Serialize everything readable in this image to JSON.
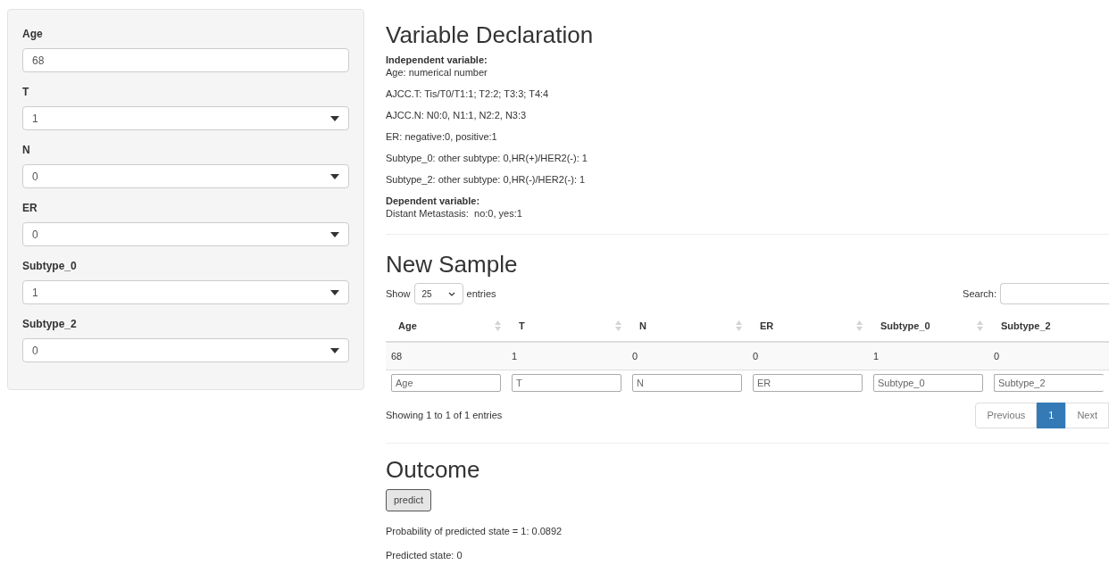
{
  "sidebar": {
    "fields": [
      {
        "label": "Age",
        "kind": "number",
        "value": "68"
      },
      {
        "label": "T",
        "kind": "select",
        "value": "1"
      },
      {
        "label": "N",
        "kind": "select",
        "value": "0"
      },
      {
        "label": "ER",
        "kind": "select",
        "value": "0"
      },
      {
        "label": "Subtype_0",
        "kind": "select",
        "value": "1"
      },
      {
        "label": "Subtype_2",
        "kind": "select",
        "value": "0"
      }
    ]
  },
  "declaration": {
    "title": "Variable Declaration",
    "independent_heading": "Independent variable:",
    "independent_lines": [
      "Age: numerical number",
      "AJCC.T: Tis/T0/T1:1; T2:2; T3:3; T4:4",
      "AJCC.N: N0:0, N1:1, N2:2, N3:3",
      "ER: negative:0, positive:1",
      "Subtype_0: other subtype: 0,HR(+)/HER2(-): 1",
      "Subtype_2: other subtype: 0,HR(-)/HER2(-): 1"
    ],
    "dependent_heading": "Dependent variable:",
    "dependent_lines": [
      "Distant Metastasis:  no:0, yes:1"
    ]
  },
  "new_sample": {
    "title": "New Sample",
    "length_prefix": "Show",
    "length_value": "25",
    "length_suffix": "entries",
    "search_label": "Search:",
    "table": {
      "columns": [
        "Age",
        "T",
        "N",
        "ER",
        "Subtype_0",
        "Subtype_2"
      ],
      "rows": [
        [
          "68",
          "1",
          "0",
          "0",
          "1",
          "0"
        ]
      ],
      "filters": [
        {
          "placeholder": "Age"
        },
        {
          "placeholder": "T"
        },
        {
          "placeholder": "N"
        },
        {
          "placeholder": "ER"
        },
        {
          "placeholder": "Subtype_0"
        },
        {
          "placeholder": "Subtype_2"
        }
      ]
    },
    "info": "Showing 1 to 1 of 1 entries",
    "pagination": [
      {
        "label": "Previous",
        "selected": false
      },
      {
        "label": "1",
        "selected": true
      },
      {
        "label": "Next",
        "selected": false
      }
    ]
  },
  "outcome": {
    "title": "Outcome",
    "button": "predict",
    "results": [
      "Probability of predicted state = 1: 0.0892",
      "Predicted state: 0"
    ]
  }
}
